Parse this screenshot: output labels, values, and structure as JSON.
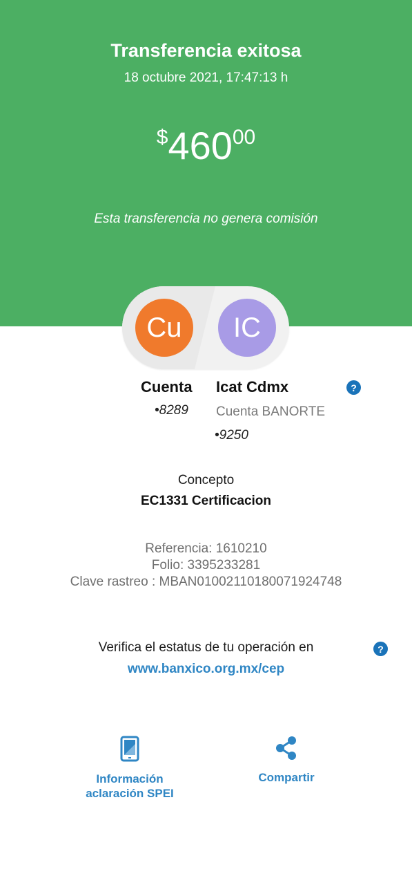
{
  "header": {
    "title": "Transferencia exitosa",
    "datetime": "18 octubre 2021, 17:47:13 h",
    "amount": {
      "currency_symbol": "$",
      "integer": "460",
      "cents": "00"
    },
    "commission_note": "Esta transferencia no genera comisión",
    "background_color": "#4caf63"
  },
  "transfer": {
    "from": {
      "initials": "Cu",
      "name": "Cuenta",
      "account": "8289",
      "avatar_color": "#f07a2c"
    },
    "to": {
      "initials": "IC",
      "name": "Icat Cdmx",
      "bank": "Cuenta BANORTE",
      "account": "9250",
      "avatar_color": "#a89be6"
    }
  },
  "concept": {
    "label": "Concepto",
    "value": "EC1331 Certificacion"
  },
  "references": {
    "referencia": "Referencia: 1610210",
    "folio": "Folio: 3395233281",
    "clave_rastreo": "Clave rastreo : MBAN01002110180071924748"
  },
  "verify": {
    "text": "Verifica el estatus de tu operación en",
    "link": "www.banxico.org.mx/cep"
  },
  "actions": {
    "info_line1": "Información",
    "info_line2": "aclaración SPEI",
    "share": "Compartir",
    "info_icon": "phone-icon",
    "share_icon": "share-icon"
  },
  "icons": {
    "help": "?"
  },
  "colors": {
    "accent_blue": "#2f86c4",
    "help_blue": "#1a73b9"
  }
}
